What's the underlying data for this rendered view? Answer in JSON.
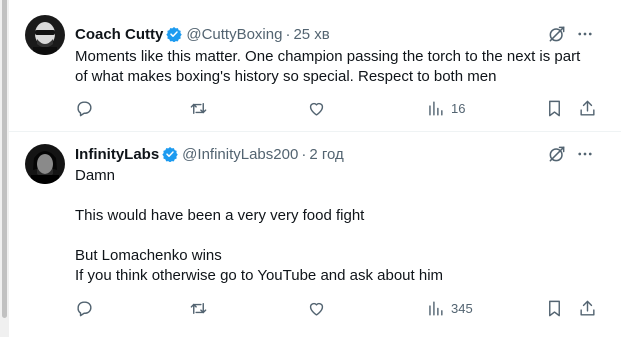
{
  "tweets": [
    {
      "name": "Coach Cutty",
      "handle": "@CuttyBoxing",
      "separator": "·",
      "time": "25 хв",
      "lines": [
        "Moments like this matter. One champion passing the torch to the next is part",
        "of what makes boxing's history so special. Respect to both men"
      ],
      "views": "16"
    },
    {
      "name": "InfinityLabs",
      "handle": "@InfinityLabs200",
      "separator": "·",
      "time": "2 год",
      "lines": [
        "Damn",
        "",
        "This would have been a very very food fight",
        "",
        "But Lomachenko wins",
        "If you think otherwise go to YouTube and ask about him"
      ],
      "views": "345"
    }
  ],
  "colors": {
    "verified": "#1d9bf0",
    "secondary_text": "#536471",
    "primary_text": "#0f1419"
  }
}
